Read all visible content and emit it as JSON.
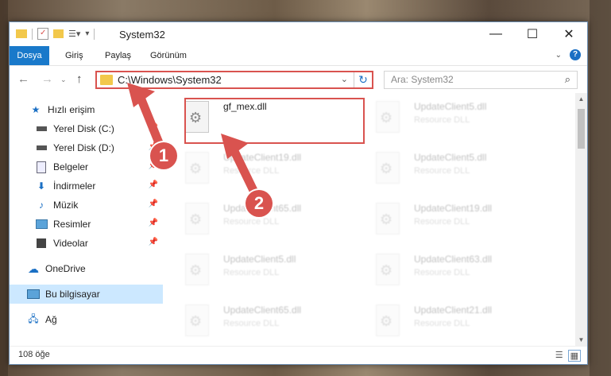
{
  "window": {
    "title": "System32",
    "controls": {
      "minimize": "—",
      "maximize": "☐",
      "close": "✕"
    }
  },
  "ribbon": {
    "tabs": [
      "Dosya",
      "Giriş",
      "Paylaş",
      "Görünüm"
    ],
    "help": "?"
  },
  "navigation": {
    "address_path": "C:\\Windows\\System32",
    "search_placeholder": "Ara: System32"
  },
  "sidebar": {
    "items": [
      {
        "label": "Hızlı erişim",
        "icon": "star-icon",
        "pinned": false
      },
      {
        "label": "Yerel Disk (C:)",
        "icon": "drive-icon",
        "pinned": true
      },
      {
        "label": "Yerel Disk (D:)",
        "icon": "drive-icon",
        "pinned": true
      },
      {
        "label": "Belgeler",
        "icon": "documents-icon",
        "pinned": true
      },
      {
        "label": "İndirmeler",
        "icon": "download-icon",
        "pinned": true
      },
      {
        "label": "Müzik",
        "icon": "music-icon",
        "pinned": true
      },
      {
        "label": "Resimler",
        "icon": "pictures-icon",
        "pinned": true
      },
      {
        "label": "Videolar",
        "icon": "video-icon",
        "pinned": true
      },
      {
        "label": "OneDrive",
        "icon": "cloud-icon",
        "pinned": false
      },
      {
        "label": "Bu bilgisayar",
        "icon": "computer-icon",
        "pinned": false
      },
      {
        "label": "Ağ",
        "icon": "network-icon",
        "pinned": false
      }
    ]
  },
  "files": {
    "highlighted": {
      "name": "gf_mex.dll",
      "type": ""
    },
    "faded": [
      {
        "name": "UpdateClient5.dll",
        "type": "Resource DLL"
      },
      {
        "name": "UpdateClient19.dll",
        "type": "Resource DLL"
      },
      {
        "name": "UpdateClient5.dll",
        "type": "Resource DLL"
      },
      {
        "name": "UpdateClient65.dll",
        "type": "Resource DLL"
      },
      {
        "name": "UpdateClient19.dll",
        "type": "Resource DLL"
      },
      {
        "name": "UpdateClient5.dll",
        "type": "Resource DLL"
      },
      {
        "name": "UpdateClient63.dll",
        "type": "Resource DLL"
      },
      {
        "name": "UpdateClient65.dll",
        "type": "Resource DLL"
      },
      {
        "name": "UpdateClient21.dll",
        "type": "Resource DLL"
      }
    ]
  },
  "status": {
    "item_count": "108 öğe"
  },
  "callouts": {
    "step1": "1",
    "step2": "2"
  },
  "colors": {
    "accent": "#1979ca",
    "highlight": "#d9534f",
    "selected": "#cce8ff"
  }
}
